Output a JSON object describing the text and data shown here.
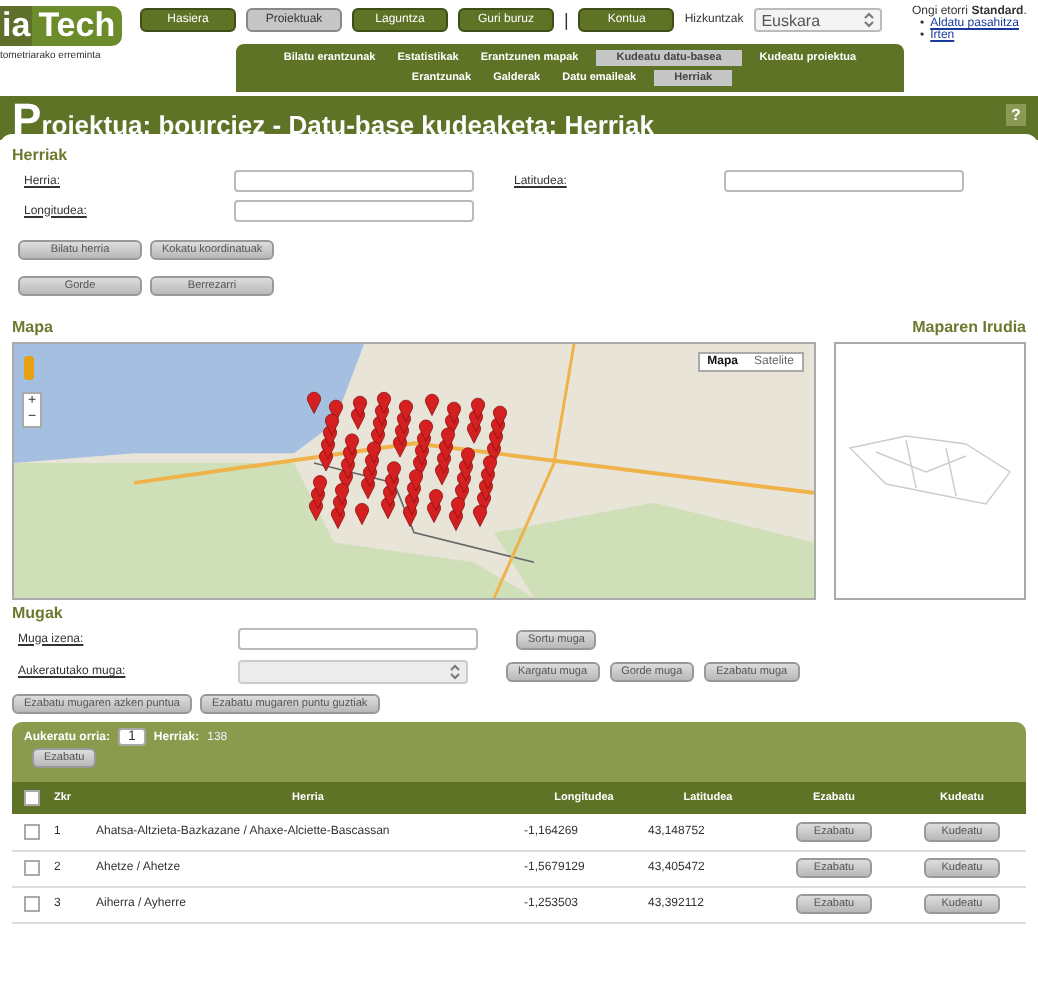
{
  "logo": {
    "prefix": "ia",
    "main": "Tech",
    "tagline": "tometriarako erreminta"
  },
  "nav": {
    "main": [
      {
        "label": "Hasiera",
        "selected": false
      },
      {
        "label": "Proiektuak",
        "selected": true
      },
      {
        "label": "Laguntza",
        "selected": false
      },
      {
        "label": "Guri buruz",
        "selected": false
      }
    ],
    "separator": "|",
    "account": [
      {
        "label": "Kontua",
        "selected": false
      }
    ]
  },
  "language": {
    "label": "Hizkuntzak",
    "value": "Euskara"
  },
  "user": {
    "greeting": "Ongi etorri **Standard**.",
    "links": [
      {
        "bullet": "•",
        "label": "Aldatu pasahitza"
      },
      {
        "bullet": "•",
        "label": "Irten"
      }
    ]
  },
  "subnav": [
    [
      {
        "label": "Bilatu erantzunak",
        "selected": false
      },
      {
        "label": "Estatistikak",
        "selected": false
      },
      {
        "label": "Erantzunen mapak",
        "selected": false
      },
      {
        "label": "Kudeatu datu-basea",
        "selected": true
      },
      {
        "label": "Kudeatu proiektua",
        "selected": false
      }
    ],
    [
      {
        "label": "Erantzunak",
        "selected": false
      },
      {
        "label": "Galderak",
        "selected": false
      },
      {
        "label": "Datu emaileak",
        "selected": false
      },
      {
        "label": "Herriak",
        "selected": true
      }
    ]
  ],
  "page_title": "Proiektua: bourciez - Datu-base kudeaketa: Herriak",
  "help": "?",
  "herriak": {
    "heading": "Herriak",
    "fields": [
      {
        "label": "Herria:"
      },
      {
        "label": "Latitudea:"
      },
      {
        "label": "Longitudea:"
      }
    ],
    "buttons": [
      [
        "Bilatu herria",
        "Kokatu koordinatuak"
      ],
      [
        "Gorde",
        "Berrezarri"
      ]
    ]
  },
  "map": {
    "heading": "Mapa",
    "types": [
      {
        "label": "Mapa",
        "selected": true
      },
      {
        "label": "Satelite",
        "selected": false
      }
    ],
    "zoom_in": "+",
    "zoom_out": "−"
  },
  "map_image": {
    "heading": "Maparen Irudia"
  },
  "mugak": {
    "heading": "Mugak",
    "rows": [
      {
        "kind": "input",
        "label": "Muga izena:",
        "buttons": [
          "Sortu muga"
        ]
      },
      {
        "kind": "select",
        "label": "Aukeratutako muga:",
        "buttons": [
          "Kargatu muga",
          "Gorde muga",
          "Ezabatu muga"
        ]
      }
    ],
    "buttons": [
      "Ezabatu mugaren azken puntua",
      "Ezabatu mugaren puntu guztiak"
    ]
  },
  "pager": {
    "label": "Aukeratu orria:",
    "page": "1",
    "count_label": "Herriak:",
    "count": "138",
    "button": "Ezabatu"
  },
  "table": {
    "header_checked": false,
    "columns": [
      "Zkr",
      "Herria",
      "Longitudea",
      "Latitudea",
      "Ezabatu",
      "Kudeatu"
    ],
    "rows": [
      {
        "checked": false,
        "number": "1",
        "name": "Ahatsa-Altzieta-Bazkazane / Ahaxe-Alciette-Bascassan",
        "longitude": "-1,164269",
        "latitude": "43,148752",
        "delete": "Ezabatu",
        "manage": "Kudeatu"
      },
      {
        "checked": false,
        "number": "2",
        "name": "Ahetze / Ahetze",
        "longitude": "-1,5679129",
        "latitude": "43,405472",
        "delete": "Ezabatu",
        "manage": "Kudeatu"
      },
      {
        "checked": false,
        "number": "3",
        "name": "Aiherra / Ayherre",
        "longitude": "-1,253503",
        "latitude": "43,392112",
        "delete": "Ezabatu",
        "manage": "Kudeatu"
      }
    ]
  }
}
